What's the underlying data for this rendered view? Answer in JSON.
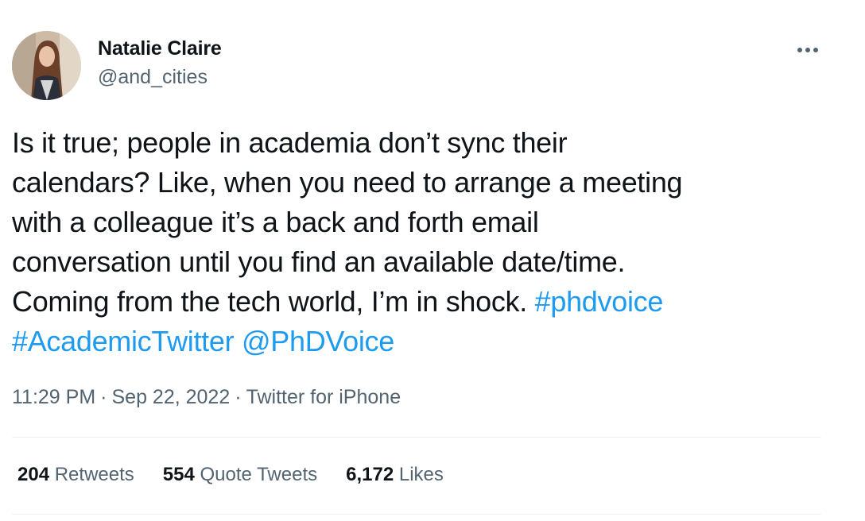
{
  "author": {
    "name": "Natalie Claire",
    "handle": "@and_cities"
  },
  "tweet": {
    "lines": [
      "Is it true; people in academia don’t sync their",
      "calendars? Like, when you need to arrange a meeting",
      "with a colleague it’s a back and forth email",
      "conversation until you find an available date/time.",
      "Coming from the tech world, I’m in shock. "
    ],
    "hashtag_1": "#phdvoice",
    "hashtag_2": "#AcademicTwitter",
    "mention": "@PhDVoice"
  },
  "meta": {
    "time": "11:29 PM",
    "separator": "·",
    "date": "Sep 22, 2022",
    "source": "Twitter for iPhone"
  },
  "stats": {
    "retweets_count": "204",
    "retweets_label": "Retweets",
    "quotes_count": "554",
    "quotes_label": "Quote Tweets",
    "likes_count": "6,172",
    "likes_label": "Likes"
  },
  "icons": {
    "more": "more-horizontal-icon"
  },
  "colors": {
    "text": "#0f1419",
    "secondary": "#536471",
    "link": "#1d9bf0",
    "divider": "#eff3f4"
  }
}
